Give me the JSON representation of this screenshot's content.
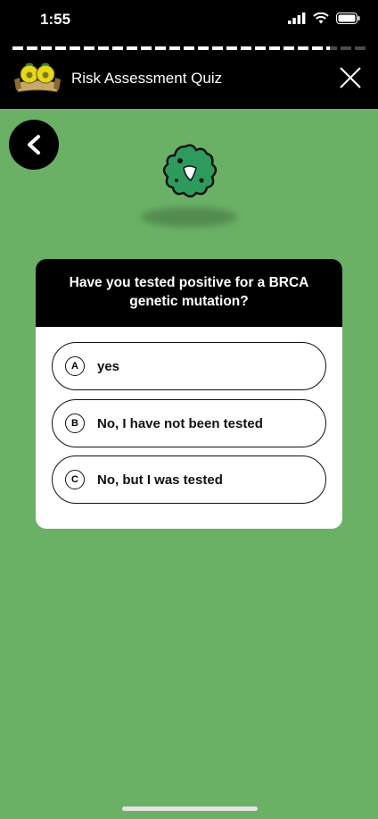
{
  "status": {
    "time": "1:55"
  },
  "progress": {
    "fraction": 0.9
  },
  "header": {
    "title": "Risk Assessment Quiz"
  },
  "question": {
    "text": "Have you tested positive for a BRCA genetic mutation?"
  },
  "options": [
    {
      "letter": "A",
      "label": "yes"
    },
    {
      "letter": "B",
      "label": "No, I have not been tested"
    },
    {
      "letter": "C",
      "label": "No, but I was tested"
    }
  ],
  "colors": {
    "background": "#6ab165",
    "mascot": "#2e9b5e",
    "bar": "#000000"
  },
  "icons": {
    "back": "chevron-left-icon",
    "close": "close-icon",
    "mascot": "cell-mascot-icon",
    "logo": "app-logo-icon"
  }
}
